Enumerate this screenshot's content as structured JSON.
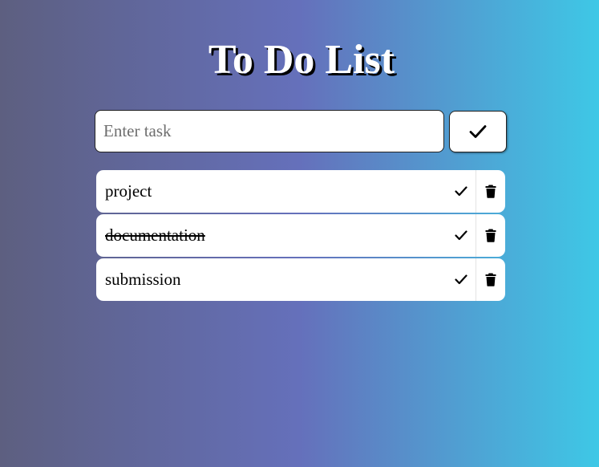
{
  "header": {
    "title": "To Do List"
  },
  "form": {
    "placeholder": "Enter task",
    "value": "",
    "add_icon": "check-icon"
  },
  "tasks": [
    {
      "text": "project",
      "completed": false,
      "complete_icon": "check-icon",
      "delete_icon": "trash-icon"
    },
    {
      "text": "documentation",
      "completed": true,
      "complete_icon": "check-icon",
      "delete_icon": "trash-icon"
    },
    {
      "text": "submission",
      "completed": false,
      "complete_icon": "check-icon",
      "delete_icon": "trash-icon"
    }
  ],
  "colors": {
    "gradient_left": "#5d5f80",
    "gradient_mid": "#6570bb",
    "gradient_right": "#3ec8e6",
    "card": "#ffffff"
  }
}
